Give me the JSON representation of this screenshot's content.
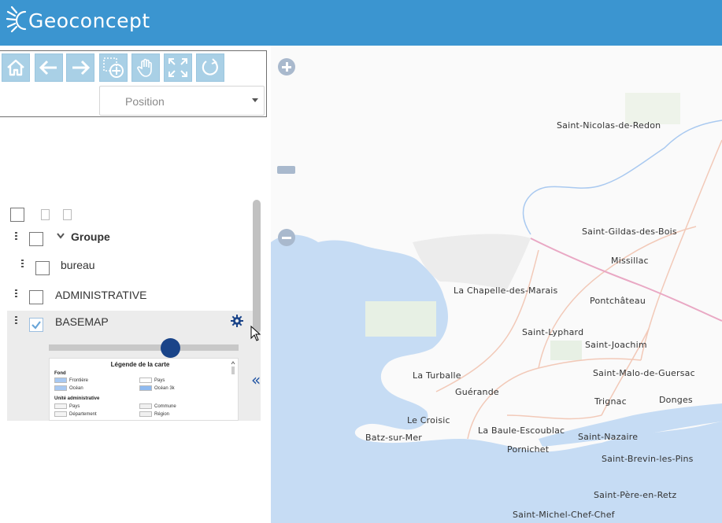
{
  "header": {
    "logo_text": "Geoconcept",
    "brand_color": "#3b95d0"
  },
  "toolbar": {
    "buttons": [
      {
        "name": "home-button",
        "icon": "home-icon"
      },
      {
        "name": "back-button",
        "icon": "arrow-left-icon"
      },
      {
        "name": "forward-button",
        "icon": "arrow-right-icon"
      },
      {
        "name": "zoom-box-button",
        "icon": "zoom-box-icon"
      },
      {
        "name": "pan-button",
        "icon": "hand-icon"
      },
      {
        "name": "full-extent-button",
        "icon": "expand-icon"
      },
      {
        "name": "refresh-button",
        "icon": "refresh-icon"
      }
    ],
    "position_select": {
      "selected": "Position"
    }
  },
  "layers": {
    "items": [
      {
        "label": "Groupe",
        "checked": false,
        "expanded": true
      },
      {
        "label": "bureau",
        "checked": false
      },
      {
        "label": "ADMINISTRATIVE",
        "checked": false
      },
      {
        "label": "BASEMAP",
        "checked": true
      }
    ],
    "basemap_opacity": 0.64,
    "legend": {
      "title": "Légende de la carte",
      "section_fond": "Fond",
      "frontiere": "Frontière",
      "pays": "Pays",
      "ocean": "Océan",
      "ocean3k": "Océan 3k",
      "section_unite": "Unité administrative",
      "pays2": "Pays",
      "commune": "Commune",
      "departement": "Département",
      "region": "Région"
    }
  },
  "map": {
    "places": [
      "Saint-Nicolas-de-Redon",
      "Saint-Gildas-des-Bois",
      "Missillac",
      "La Chapelle-des-Marais",
      "Pontchâteau",
      "Saint-Lyphard",
      "Saint-Joachim",
      "La Turballe",
      "Saint-Malo-de-Guersac",
      "Guérande",
      "Trignac",
      "Donges",
      "Le Croisic",
      "La Baule-Escoublac",
      "Saint-Nazaire",
      "Batz-sur-Mer",
      "Pornichet",
      "Saint-Brevin-les-Pins",
      "Saint-Père-en-Retz",
      "Saint-Michel-Chef-Chef"
    ],
    "colors": {
      "sea": "#c6dcf4",
      "land": "#f7f7f5",
      "river": "#a9c9f0",
      "road": "#f2c9b8",
      "highway": "#e9a8c4"
    }
  }
}
